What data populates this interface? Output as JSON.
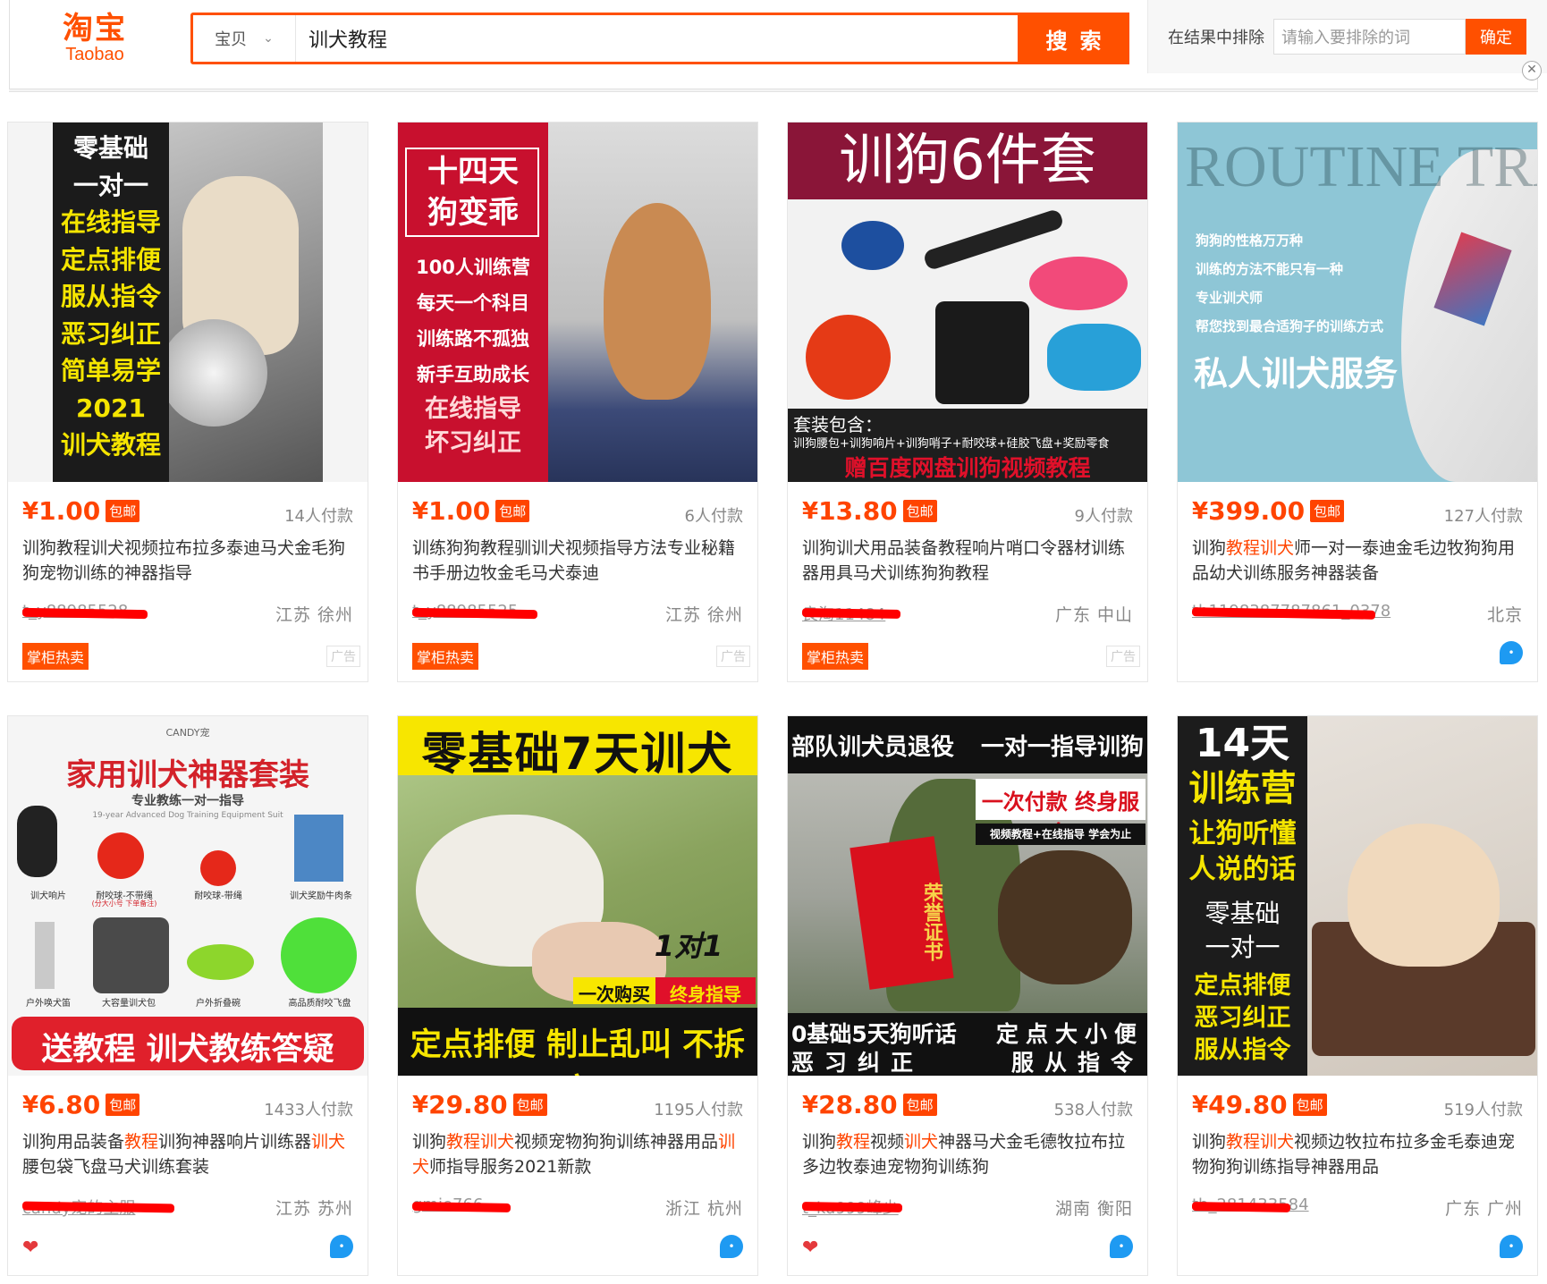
{
  "header": {
    "logo_cn": "淘宝",
    "logo_en": "Taobao",
    "category": "宝贝",
    "query": "训犬教程",
    "search_label": "搜索",
    "exclude_label": "在结果中排除",
    "exclude_placeholder": "请输入要排除的词",
    "exclude_confirm": "确定"
  },
  "colors": {
    "accent": "#ff5000",
    "price": "#ff4400"
  },
  "products": [
    {
      "price_yen": "¥",
      "price": "1.00",
      "free": "包邮",
      "sales": "14人付款",
      "title": "训狗教程训犬视频拉布拉多泰迪马犬金毛狗狗宠物训练的神器指导",
      "shop": "t_y88985528",
      "location": "江苏 徐州",
      "tag": "掌柜热卖",
      "ad": "广告",
      "img_lines": [
        "零基础",
        "一对一",
        "在线指导",
        "定点排便",
        "服从指令",
        "恶习纠正",
        "简单易学",
        "2021",
        "训犬教程"
      ]
    },
    {
      "price_yen": "¥",
      "price": "1.00",
      "free": "包邮",
      "sales": "6人付款",
      "title": "训练狗狗教程驯训犬视频指导方法专业秘籍书手册边牧金毛马犬泰迪",
      "shop": "t_y88985525",
      "location": "江苏 徐州",
      "tag": "掌柜热卖",
      "ad": "广告",
      "img_lines": [
        "十四天",
        "狗变乖",
        "100人训练营",
        "每天一个科目",
        "训练路不孤独",
        "新手互助成长",
        "在线指导",
        "坏习纠正"
      ]
    },
    {
      "price_yen": "¥",
      "price": "13.80",
      "free": "包邮",
      "sales": "9人付款",
      "title": "训狗训犬用品装备教程响片哨口令器材训练器用具马犬训练狗狗教程",
      "shop": "良淘11484",
      "location": "广东 中山",
      "tag": "掌柜热卖",
      "ad": "广告",
      "img_lines": [
        "训狗6件套",
        "套装包含：",
        "训狗腰包+训狗响片+训狗哨子+耐咬球+硅胶飞盘+奖励零食",
        "赠百度网盘训狗视频教程"
      ]
    },
    {
      "price_yen": "¥",
      "price": "399.00",
      "free": "包邮",
      "sales": "127人付款",
      "title_parts": [
        [
          "训狗",
          false
        ],
        [
          "教程",
          true
        ],
        [
          "训犬",
          true
        ],
        [
          "师一对一泰迪金毛边牧狗狗用品幼犬训练服务神器装备",
          false
        ]
      ],
      "shop": "tb1198387787861_0378",
      "location": "北京",
      "img_lines": [
        "ROUTINE TRAINING",
        "狗狗的性格万万种",
        "训练的方法不能只有一种",
        "专业训犬师",
        "帮您找到最合适狗子的训练方式",
        "私人训犬服务"
      ]
    },
    {
      "price_yen": "¥",
      "price": "6.80",
      "free": "包邮",
      "sales": "1433人付款",
      "title_parts": [
        [
          "训狗用品装备",
          false
        ],
        [
          "教程",
          true
        ],
        [
          "训狗神器响片训练器",
          false
        ],
        [
          "训犬",
          true
        ],
        [
          "腰包袋飞盘马犬训练套装",
          false
        ]
      ],
      "shop": "candy宠的主服",
      "location": "江苏 苏州",
      "img_lines": [
        "CANDY宠",
        "家用训犬神器套装",
        "专业教练一对一指导",
        "19-year Advanced Dog Training Equipment Suit",
        "训犬响片",
        "耐咬球-不带绳",
        "(分大小号 下单备注)",
        "耐咬球-带绳",
        "训犬奖励牛肉条",
        "户外唤犬笛",
        "大容量训犬包",
        "户外折叠碗",
        "高品质耐咬飞盘",
        "送教程 训犬教练答疑"
      ]
    },
    {
      "price_yen": "¥",
      "price": "29.80",
      "free": "包邮",
      "sales": "1195人付款",
      "title_parts": [
        [
          "训狗",
          false
        ],
        [
          "教程",
          true
        ],
        [
          "训犬",
          true
        ],
        [
          "视频宠物狗狗训练神器用品",
          false
        ],
        [
          "训犬",
          true
        ],
        [
          "师指导服务2021新款",
          false
        ]
      ],
      "shop": "gmie766",
      "location": "浙江 杭州",
      "img_lines": [
        "零基础7天训犬",
        "1对1",
        "一次购买",
        "终身指导",
        "定点排便 制止乱叫 不拆家"
      ]
    },
    {
      "price_yen": "¥",
      "price": "28.80",
      "free": "包邮",
      "sales": "538人付款",
      "title_parts": [
        [
          "训狗",
          false
        ],
        [
          "教程",
          true
        ],
        [
          "视频",
          false
        ],
        [
          "训犬",
          true
        ],
        [
          "神器马犬金毛德牧拉布拉多边牧泰迪宠物狗训练狗",
          false
        ]
      ],
      "shop": "t_ku999峰少",
      "location": "湖南 衡阳",
      "img_lines": [
        "部队训犬员退役",
        "一对一指导训狗",
        "一次付款 终身服务",
        "视频教程+在线指导 学会为止",
        "荣誉证书",
        "0基础5天狗听话",
        "定点大小便",
        "恶习纠正",
        "服从指令"
      ]
    },
    {
      "price_yen": "¥",
      "price": "49.80",
      "free": "包邮",
      "sales": "519人付款",
      "title_parts": [
        [
          "训狗",
          false
        ],
        [
          "教程",
          true
        ],
        [
          "训犬",
          true
        ],
        [
          "视频边牧拉布拉多金毛泰迪宠物狗狗训练指导神器用品",
          false
        ]
      ],
      "shop": "tb_281433584",
      "location": "广东 广州",
      "img_lines": [
        "14天",
        "训练营",
        "让狗听懂",
        "人说的话",
        "零基础",
        "一对一",
        "定点排便",
        "恶习纠正",
        "服从指令"
      ]
    }
  ]
}
